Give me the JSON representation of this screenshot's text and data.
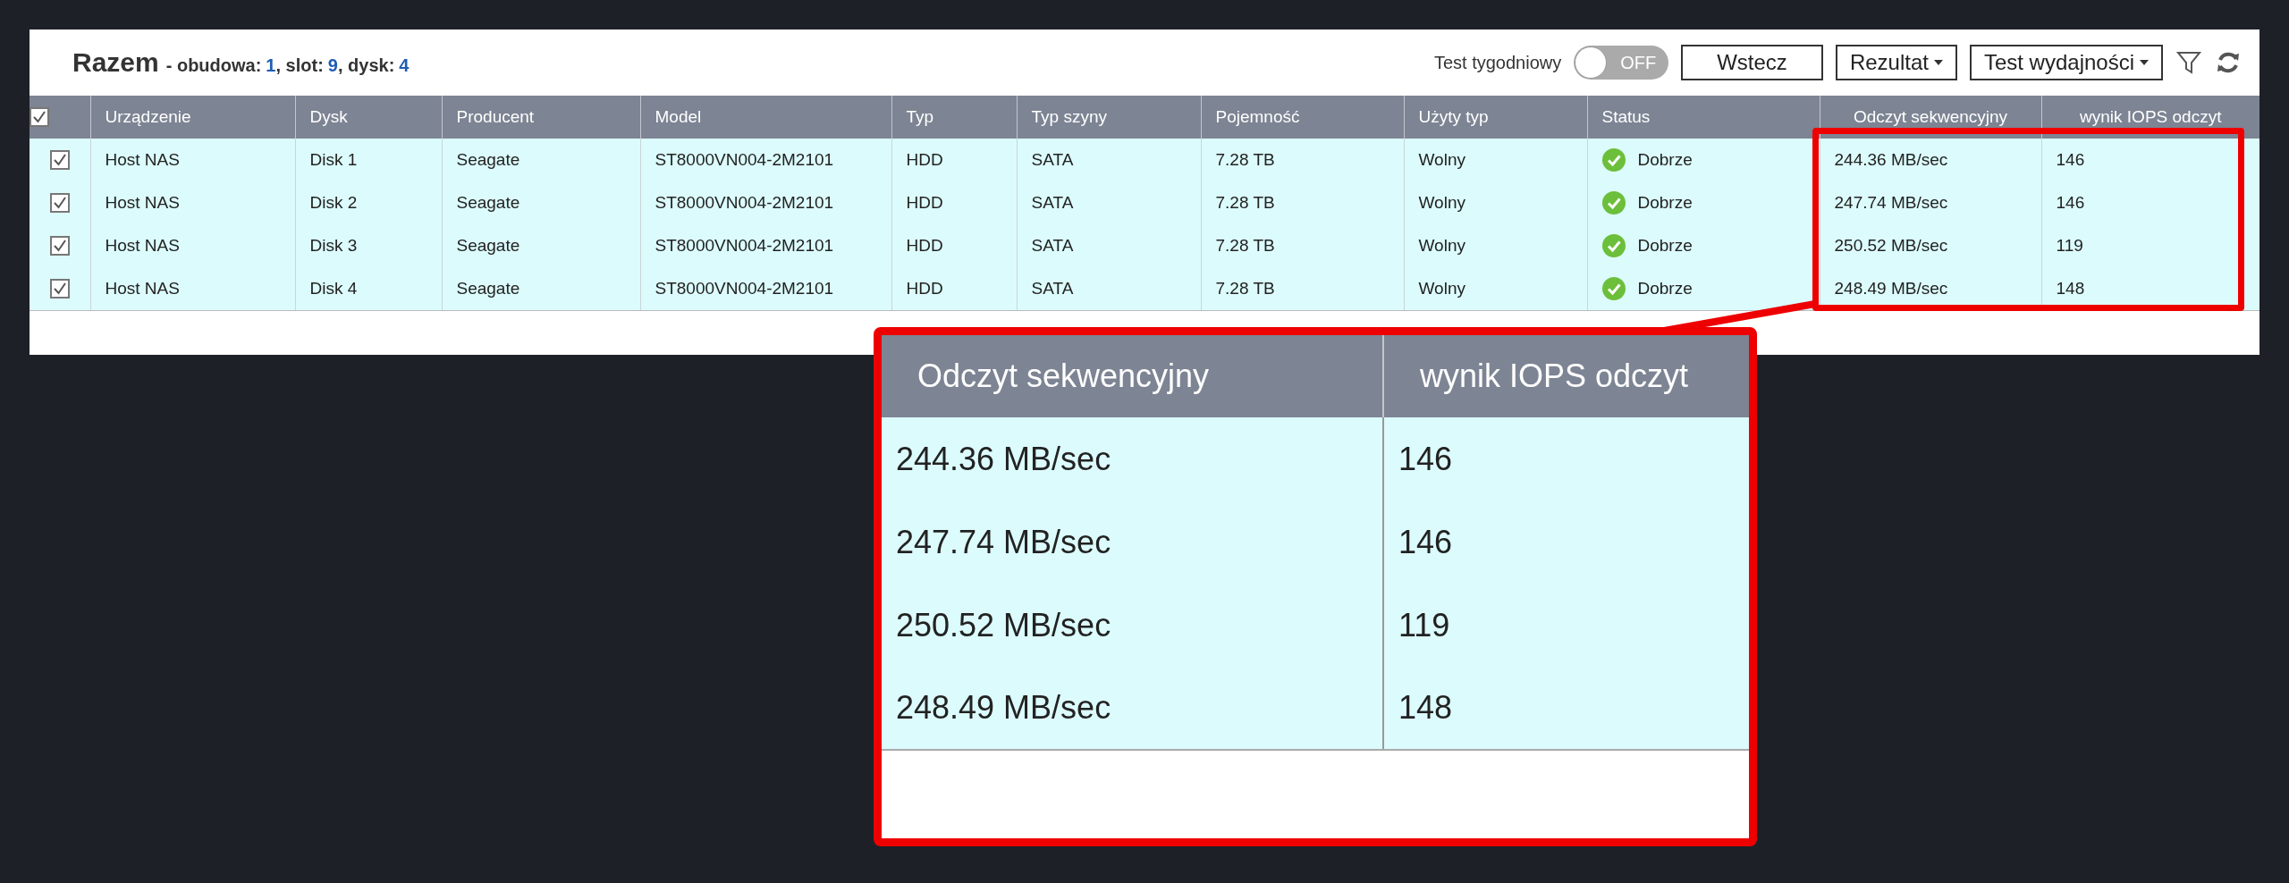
{
  "header": {
    "title": "Razem",
    "summary": [
      {
        "label": "- obudowa:",
        "value": "1"
      },
      {
        "label": ", slot:",
        "value": "9"
      },
      {
        "label": ", dysk:",
        "value": "4"
      }
    ]
  },
  "toolbar": {
    "weekly_test": {
      "label": "Test tygodniowy",
      "on": false,
      "text": "OFF"
    },
    "buttons": [
      {
        "kind": "plain",
        "label": "Wstecz"
      },
      {
        "kind": "dropdown",
        "label": "Rezultat"
      },
      {
        "kind": "dropdown",
        "label": "Test wydajności"
      }
    ],
    "icons": [
      {
        "kind": "filter"
      },
      {
        "kind": "refresh"
      }
    ]
  },
  "table": {
    "select_all": {
      "checked": true
    },
    "columns": [
      {
        "kind": "text",
        "label": "Urządzenie"
      },
      {
        "kind": "text",
        "label": "Dysk"
      },
      {
        "kind": "text",
        "label": "Producent"
      },
      {
        "kind": "text",
        "label": "Model"
      },
      {
        "kind": "text",
        "label": "Typ"
      },
      {
        "kind": "text",
        "label": "Typ szyny"
      },
      {
        "kind": "text",
        "label": "Pojemność"
      },
      {
        "kind": "text",
        "label": "Użyty typ"
      },
      {
        "kind": "status",
        "label": "Status"
      },
      {
        "kind": "numeric",
        "label": "Odczyt sekwencyjny"
      },
      {
        "kind": "numeric",
        "label": "wynik IOPS odczyt"
      }
    ],
    "rows": [
      {
        "checked": true,
        "cells": [
          "Host NAS",
          "Disk 1",
          "Seagate",
          "ST8000VN004-2M2101",
          "HDD",
          "SATA",
          "7.28 TB",
          "Wolny",
          "Dobrze",
          "244.36 MB/sec",
          "146"
        ]
      },
      {
        "checked": true,
        "cells": [
          "Host NAS",
          "Disk 2",
          "Seagate",
          "ST8000VN004-2M2101",
          "HDD",
          "SATA",
          "7.28 TB",
          "Wolny",
          "Dobrze",
          "247.74 MB/sec",
          "146"
        ]
      },
      {
        "checked": true,
        "cells": [
          "Host NAS",
          "Disk 3",
          "Seagate",
          "ST8000VN004-2M2101",
          "HDD",
          "SATA",
          "7.28 TB",
          "Wolny",
          "Dobrze",
          "250.52 MB/sec",
          "119"
        ]
      },
      {
        "checked": true,
        "cells": [
          "Host NAS",
          "Disk 4",
          "Seagate",
          "ST8000VN004-2M2101",
          "HDD",
          "SATA",
          "7.28 TB",
          "Wolny",
          "Dobrze",
          "248.49 MB/sec",
          "148"
        ]
      }
    ]
  },
  "callout": {
    "columns": [
      "Odczyt sekwencyjny",
      "wynik IOPS odczyt"
    ],
    "rows": [
      [
        "244.36 MB/sec",
        "146"
      ],
      [
        "247.74 MB/sec",
        "146"
      ],
      [
        "250.52 MB/sec",
        "119"
      ],
      [
        "248.49 MB/sec",
        "148"
      ]
    ]
  }
}
